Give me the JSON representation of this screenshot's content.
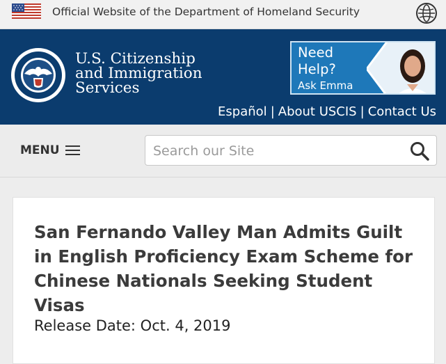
{
  "gov_banner": {
    "text": "Official Website of the Department of Homeland Security"
  },
  "header": {
    "agency_line1": "U.S. Citizenship",
    "agency_line2": "and Immigration",
    "agency_line3": "Services",
    "help_line1": "Need",
    "help_line2": "Help?",
    "help_ask": "Ask Emma",
    "links": [
      {
        "label": "Español"
      },
      {
        "label": "About USCIS"
      },
      {
        "label": "Contact Us"
      }
    ]
  },
  "toolbar": {
    "menu_label": "MENU",
    "search_placeholder": "Search our Site"
  },
  "article": {
    "title": "San Fernando Valley Man Admits Guilt in English Proficiency Exam Scheme for Chinese Nationals Seeking Student Visas",
    "release_date": "Release Date: Oct. 4, 2019"
  },
  "colors": {
    "header_bg": "#0b3c6e",
    "help_box_bg": "#1e78b9",
    "page_bg": "#ededed"
  }
}
